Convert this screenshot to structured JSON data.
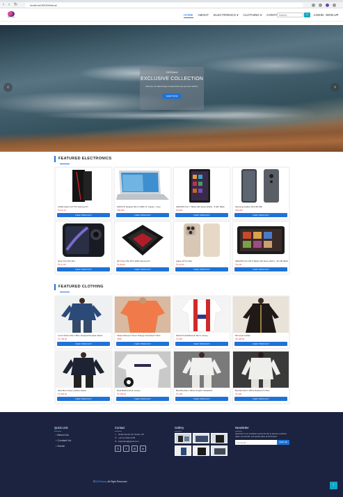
{
  "browser": {
    "url": "localhost:5000/kirana/",
    "back_icon": "back-arrow-icon",
    "forward_icon": "forward-arrow-icon",
    "reload_icon": "reload-icon"
  },
  "navbar": {
    "logo_text": "ZAYLKirana",
    "links": [
      "HOME",
      "ABOUT",
      "ELECTRONICS ▾",
      "CLOTHING ▾",
      "CONTACT"
    ],
    "active_link": "HOME",
    "search_placeholder": "Search...",
    "search_icon": "search-icon",
    "login_label": "LOGIN",
    "signup_label": "SIGN UP"
  },
  "hero": {
    "brand": "ZAYKirana",
    "title": "EXCLUSIVE COLLECTION",
    "subtitle": "Discover our latest range of electronics and premium fashion",
    "button_label": "SHOP NOW",
    "prev_icon": "chevron-left-icon",
    "next_icon": "chevron-right-icon"
  },
  "electronics": {
    "title": "FEATURED ELECTRONICS",
    "button_label": "VIEW PRODUCT",
    "products": [
      {
        "name": "ACER Aspire 3rd TX2 Gaming PC",
        "price": "₹1,06,49"
      },
      {
        "name": "LENOVO Ideapad Slim 3 AMD 14\" Laptop - Grey",
        "price": "₹38,999"
      },
      {
        "name": "AMAZON Fire 7 Tablet with Alexa (2022) - 8 GB, Black",
        "price": "₹6,999"
      },
      {
        "name": "Samsung Galaxy S9 (128 GB)",
        "price": "₹48,999"
      },
      {
        "name": "Oppo Find X8 Ultra",
        "price": "₹1,07,99"
      },
      {
        "name": "HP Omen 25L RTX 4060 Gaming PC",
        "price": "₹1,89,99"
      },
      {
        "name": "Apple 16 Pro Max",
        "price": "₹1,44,90"
      },
      {
        "name": "AMAZON Fire HD 8 Tablet with Alexa (2017) - 32 GB, Black",
        "price": "₹12,99"
      }
    ]
  },
  "clothing": {
    "title": "FEATURED CLOTHING",
    "button_label": "VIEW PRODUCT",
    "products": [
      {
        "name": "Louis Vuitton Men's Blue Jacquard Hooded Jacket",
        "price": "₹1,799.00"
      },
      {
        "name": "Jaipan Women's Neon Orange Oversized T-Shirt",
        "price": "₹899"
      },
      {
        "name": "Mantel Fussballverein Men's Jersey",
        "price": "₹3,499"
      },
      {
        "name": "Moroccan Kaftan",
        "price": "₹5,499.00"
      },
      {
        "name": "Zara Men's Navy Quilted Jacket",
        "price": "₹1,999.00"
      },
      {
        "name": "Real Madrid Home Jersey",
        "price": "₹1,299.00"
      },
      {
        "name": "Bershka Men's White Graphic Sweatshirt",
        "price": "₹1,299"
      },
      {
        "name": "Bershka Men's White Relaxed Fit Shirt",
        "price": "₹1,299"
      }
    ]
  },
  "footer": {
    "quick_links_title": "Quick Link",
    "quick_links": [
      "› About Us",
      "› Contact Us",
      "› Home"
    ],
    "contact_title": "Contact",
    "contact_lines": [
      "Noida Sector 62, Noida, UP",
      "+91 11-4012 3745",
      "zaykirana@gmail.com"
    ],
    "contact_icons": [
      "location-icon",
      "phone-icon",
      "email-icon"
    ],
    "social_icons": [
      "twitter-icon",
      "facebook-icon",
      "instagram-icon",
      "linkedin-icon"
    ],
    "gallery_title": "Gallery",
    "newsletter_title": "Newsletter",
    "newsletter_text": "Subscribe to our newsletter and be the first to discover exclusive deals, new arrivals, and special offers at ZAYKirana!",
    "newsletter_placeholder": "Your Email",
    "newsletter_button": "SIGN UP",
    "copyright_prefix": "©",
    "copyright_brand": "ZAYKirana",
    "copyright_suffix": ", All Right Reserved.",
    "back_to_top_icon": "arrow-up-icon"
  },
  "colors": {
    "accent": "#1e73d8",
    "price": "#e53935",
    "footer_bg": "#1c2340",
    "search_button": "#12a6c3"
  }
}
